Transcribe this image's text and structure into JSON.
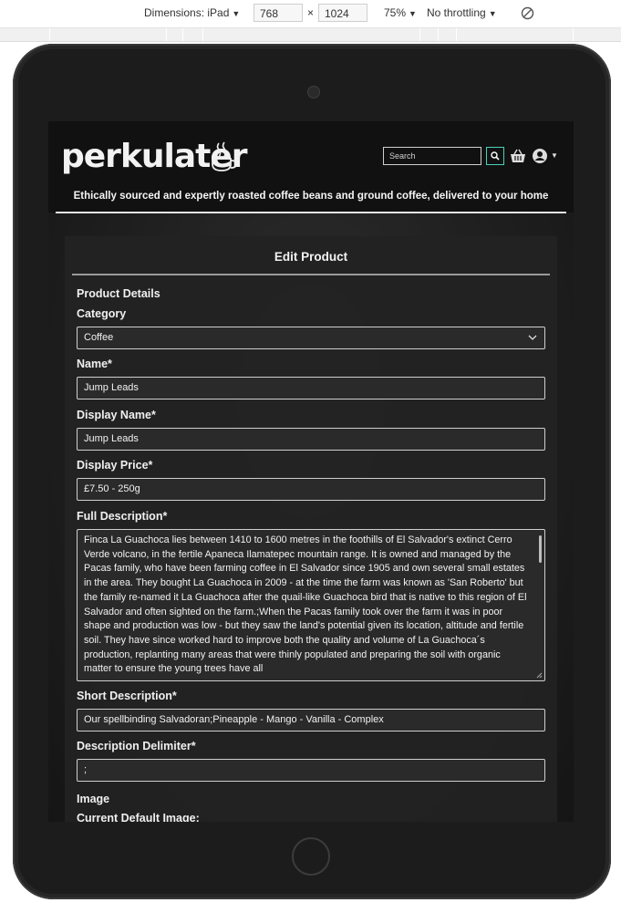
{
  "devtools": {
    "dimensions_label": "Dimensions: iPad",
    "width": "768",
    "times": "×",
    "height": "1024",
    "zoom": "75%",
    "throttling": "No throttling"
  },
  "site": {
    "logo_text": "perkulater",
    "tagline": "Ethically sourced and expertly roasted coffee beans and ground coffee, delivered to your home",
    "search_placeholder": "Search"
  },
  "form": {
    "title": "Edit Product",
    "section_details": "Product Details",
    "category_label": "Category",
    "category_value": "Coffee",
    "name_label": "Name*",
    "name_value": "Jump Leads",
    "display_name_label": "Display Name*",
    "display_name_value": "Jump Leads",
    "display_price_label": "Display Price*",
    "display_price_value": "£7.50 - 250g",
    "full_description_label": "Full Description*",
    "full_description_value": "Finca La Guachoca lies between 1410 to 1600 metres in the foothills of El Salvador's extinct Cerro Verde volcano, in the fertile Apaneca Ilamatepec mountain range. It is owned and managed by the Pacas family, who have been farming coffee in El Salvador since 1905 and own several small estates in the area. They bought La Guachoca in 2009 - at the time the farm was known as 'San Roberto' but the family re-named it La Guachoca after the quail-like Guachoca bird that is native to this region of El Salvador and often sighted on the farm.;When the Pacas family took over the farm it was in poor shape and production was low - but they saw the land's potential given its location, altitude and fertile soil. They have since worked hard to improve both the quality and volume of La Guachoca´s production, replanting many areas that were thinly populated and preparing the soil with organic matter to ensure the young trees have all",
    "short_description_label": "Short Description*",
    "short_description_value": "Our spellbinding Salvadoran;Pineapple - Mango - Vanilla - Complex",
    "delimiter_label": "Description Delimiter*",
    "delimiter_value": ";",
    "image_heading": "Image",
    "current_image_label": "Current Default Image:"
  },
  "colors": {
    "search_button_border": "#4bd0b8",
    "page_header": "#111111",
    "card_background": "#222222"
  }
}
